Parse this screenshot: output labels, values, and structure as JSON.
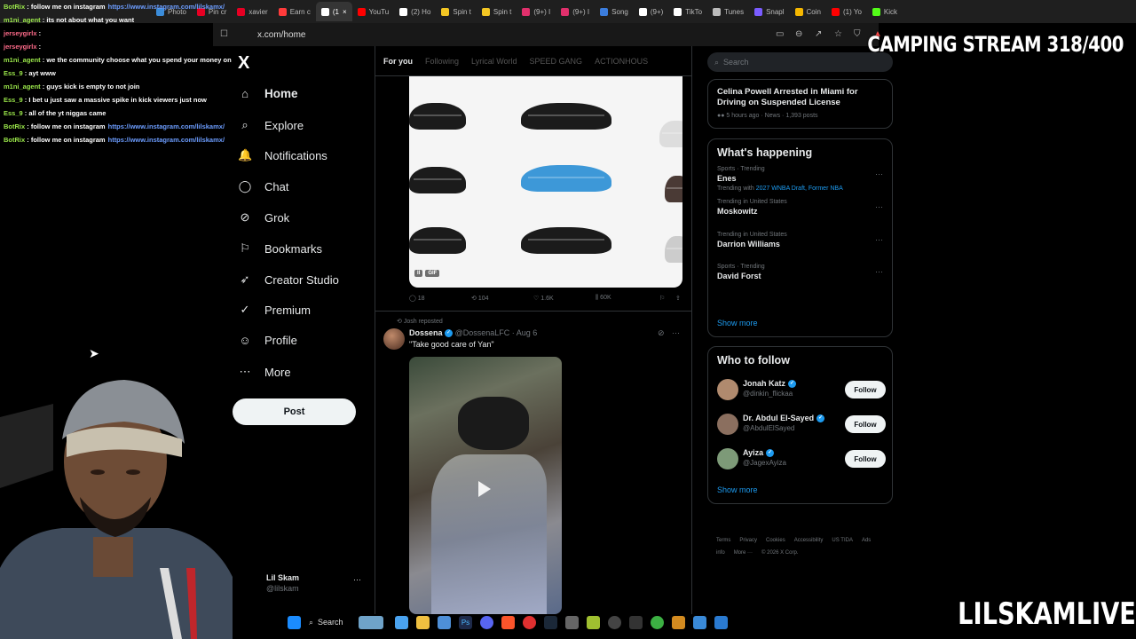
{
  "browser": {
    "tabs": [
      {
        "label": "Photo",
        "color": "#3b8cd9"
      },
      {
        "label": "Pin cr",
        "color": "#e60023"
      },
      {
        "label": "xavier",
        "color": "#e60023"
      },
      {
        "label": "Earn c",
        "color": "#ff3b3b"
      },
      {
        "label": "(1",
        "color": "#ffffff",
        "active": true
      },
      {
        "label": "YouTu",
        "color": "#ff0000"
      },
      {
        "label": "(2) Ho",
        "color": "#ffffff"
      },
      {
        "label": "Spin t",
        "color": "#f3c623"
      },
      {
        "label": "Spin t",
        "color": "#f3c623"
      },
      {
        "label": "(9+) I",
        "color": "#e1306c"
      },
      {
        "label": "(9+) I",
        "color": "#e1306c"
      },
      {
        "label": "Song",
        "color": "#3b7ddd"
      },
      {
        "label": "(9+)",
        "color": "#ffffff"
      },
      {
        "label": "TikTo",
        "color": "#ffffff"
      },
      {
        "label": "Tunes",
        "color": "#bbbbbb"
      },
      {
        "label": "Snapl",
        "color": "#7a5cff"
      },
      {
        "label": "Coin",
        "color": "#f5b700"
      },
      {
        "label": "(1) Yo",
        "color": "#ff0000"
      },
      {
        "label": "Kick",
        "color": "#53fc18"
      }
    ],
    "address": "x.com/home"
  },
  "stream": {
    "title": "CAMPING STREAM 318/400",
    "channel": "LILSKAMLIVE"
  },
  "chat": [
    {
      "user": "BotRix",
      "msg": "follow me on instagram",
      "link": "https://www.instagram.com/lilskamx/"
    },
    {
      "user": "m1ni_agent",
      "msg": "its not about what you want"
    },
    {
      "user": "jerseygirlx",
      "msg": ""
    },
    {
      "user": "jerseygirlx",
      "msg": ""
    },
    {
      "user": "m1ni_agent",
      "msg": "we the community choose what you spend your money on"
    },
    {
      "user": "Ess_9",
      "msg": "ayt www"
    },
    {
      "user": "m1ni_agent",
      "msg": "guys kick is empty to not join"
    },
    {
      "user": "Ess_9",
      "msg": "I bet u just saw a massive spike in kick viewers just now"
    },
    {
      "user": "Ess_9",
      "msg": "all of the yt niggas came"
    },
    {
      "user": "BotRix",
      "msg": "follow me on instagram",
      "link": "https://www.instagram.com/lilskamx/"
    },
    {
      "user": "BotRix",
      "msg": "follow me on instagram",
      "link": "https://www.instagram.com/lilskamx/"
    }
  ],
  "sidebar": {
    "logo": "X",
    "items": [
      {
        "label": "Home",
        "icon": "home-icon",
        "glyph": "⌂"
      },
      {
        "label": "Explore",
        "icon": "search-icon",
        "glyph": "⌕"
      },
      {
        "label": "Notifications",
        "icon": "bell-icon",
        "glyph": "🔔"
      },
      {
        "label": "Chat",
        "icon": "chat-icon",
        "glyph": "◯"
      },
      {
        "label": "Grok",
        "icon": "grok-icon",
        "glyph": "⊘"
      },
      {
        "label": "Bookmarks",
        "icon": "bookmark-icon",
        "glyph": "⚐"
      },
      {
        "label": "Creator Studio",
        "icon": "rocket-icon",
        "glyph": "➶"
      },
      {
        "label": "Premium",
        "icon": "premium-icon",
        "glyph": "✓"
      },
      {
        "label": "Profile",
        "icon": "profile-icon",
        "glyph": "☺"
      },
      {
        "label": "More",
        "icon": "more-icon",
        "glyph": "⋯"
      }
    ],
    "post_label": "Post",
    "account": {
      "name": "Lil Skam",
      "handle": "@lilskam"
    }
  },
  "feed": {
    "tabs": [
      "For you",
      "Following",
      "Lyrical World",
      "SPEED GANG",
      "ACTIONHOUS"
    ],
    "gif_badges": [
      "II",
      "GIF"
    ],
    "stats1": {
      "replies": "18",
      "reposts": "104",
      "likes": "1.6K",
      "views": "60K"
    },
    "repost_label": "Josh reposted",
    "tweet": {
      "name": "Dossena",
      "handle": "@DossenaLFC",
      "date": "· Aug 6",
      "text": "\"Take good care of Yan\""
    }
  },
  "right": {
    "search_placeholder": "Search",
    "news": {
      "headline": "Celina Powell Arrested in Miami for Driving on Suspended License",
      "meta": "5 hours ago · News · 1,393 posts"
    },
    "happening_title": "What's happening",
    "trends": [
      {
        "context": "Sports · Trending",
        "name": "Enes",
        "with": "Trending with ",
        "links": "2027 WNBA Draft, Former NBA"
      },
      {
        "context": "Trending in United States",
        "name": "Moskowitz",
        "with": "",
        "links": ""
      },
      {
        "context": "Trending in United States",
        "name": "Darrion Williams",
        "with": "",
        "links": ""
      },
      {
        "context": "Sports · Trending",
        "name": "David Forst",
        "with": "",
        "links": ""
      }
    ],
    "show_more": "Show more",
    "who_title": "Who to follow",
    "who": [
      {
        "name": "Jonah Katz",
        "handle": "@dinkin_flickaa",
        "follow": "Follow",
        "color": "#b08a6e"
      },
      {
        "name": "Dr. Abdul El-Sayed",
        "handle": "@AbdulElSayed",
        "follow": "Follow",
        "color": "#8b6f5f"
      },
      {
        "name": "Ayiza",
        "handle": "@JagexAyiza",
        "follow": "Follow",
        "color": "#7d9a78"
      }
    ],
    "footer": [
      "Terms",
      "Privacy",
      "Cookies",
      "Accessibility",
      "US TIDA",
      "Ads info",
      "More ···",
      "© 2026 X Corp."
    ]
  },
  "taskbar": {
    "search": "Search"
  }
}
